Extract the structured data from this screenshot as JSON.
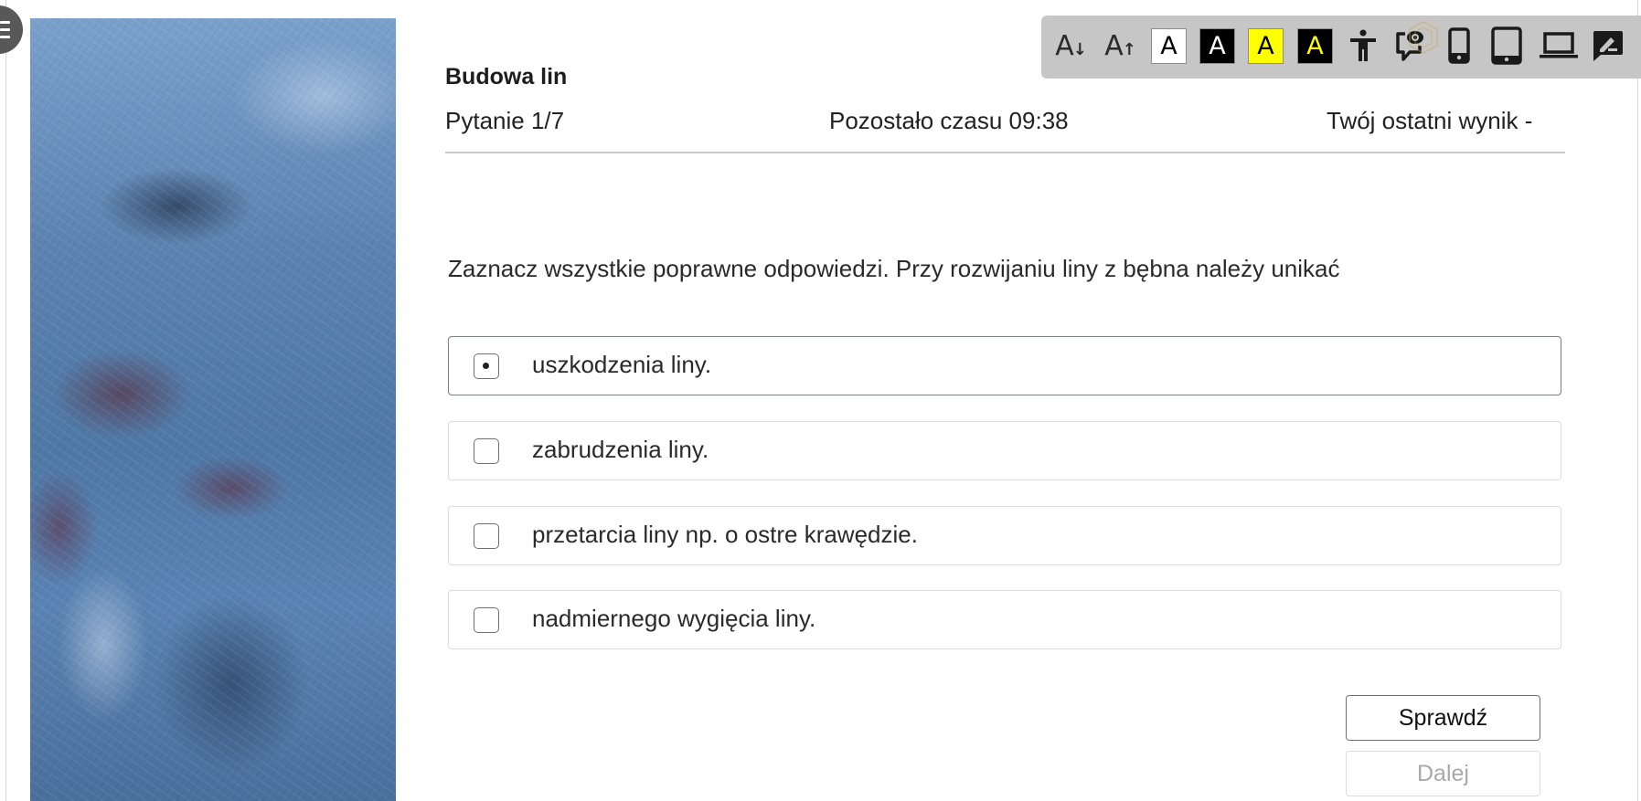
{
  "menu": {
    "icon": "hamburger-menu-icon"
  },
  "toolbar": {
    "items": [
      {
        "name": "decrease-font",
        "glyph": "A",
        "arrow": "↓",
        "icon": "font-decrease-icon"
      },
      {
        "name": "increase-font",
        "glyph": "A",
        "arrow": "↑",
        "icon": "font-increase-icon"
      },
      {
        "name": "contrast-white-black",
        "glyph": "A",
        "bg": "#ffffff",
        "fg": "#000000"
      },
      {
        "name": "contrast-black-white",
        "glyph": "A",
        "bg": "#000000",
        "fg": "#ffffff"
      },
      {
        "name": "contrast-yellow-black",
        "glyph": "A",
        "bg": "#ffff00",
        "fg": "#000000"
      },
      {
        "name": "contrast-black-yellow",
        "glyph": "A",
        "bg": "#000000",
        "fg": "#ffff00"
      },
      {
        "name": "accessibility",
        "icon": "accessibility-person-icon"
      },
      {
        "name": "audio-description",
        "icon": "speech-bubble-eye-icon"
      },
      {
        "name": "view-phone",
        "icon": "smartphone-icon"
      },
      {
        "name": "view-tablet",
        "icon": "tablet-icon"
      },
      {
        "name": "view-laptop",
        "icon": "laptop-icon"
      },
      {
        "name": "notes",
        "icon": "edit-note-icon"
      }
    ],
    "background": "#c6c6c6"
  },
  "header": {
    "title": "Budowa lin",
    "question_counter": "Pytanie 1/7",
    "time_remaining": "Pozostało czasu 09:38",
    "last_score": "Twój ostatni wynik -"
  },
  "question": {
    "text": "Zaznacz wszystkie poprawne odpowiedzi. Przy rozwijaniu liny z bębna należy unikać",
    "options": [
      {
        "label": "uszkodzenia liny.",
        "checked": false,
        "focused": true
      },
      {
        "label": "zabrudzenia liny.",
        "checked": false,
        "focused": false
      },
      {
        "label": "przetarcia liny np. o ostre krawędzie.",
        "checked": false,
        "focused": false
      },
      {
        "label": "nadmiernego wygięcia liny.",
        "checked": false,
        "focused": false
      }
    ]
  },
  "actions": {
    "check_label": "Sprawdź",
    "next_label": "Dalej",
    "next_disabled": true
  }
}
